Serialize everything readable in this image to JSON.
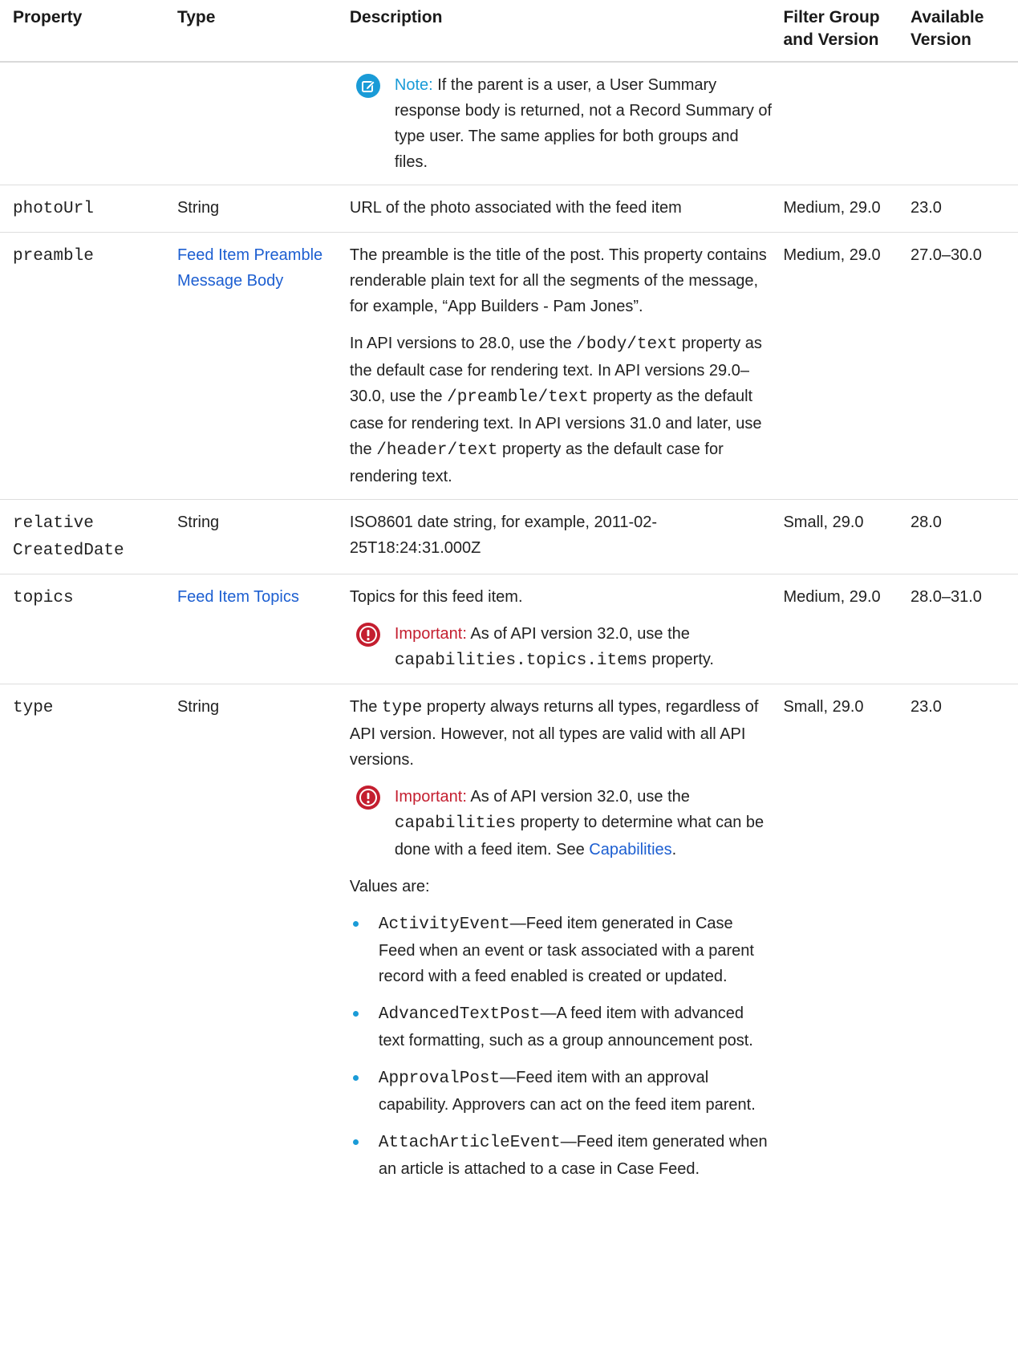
{
  "header": {
    "property": "Property",
    "type": "Type",
    "description": "Description",
    "filter": "Filter Group and Version",
    "available": "Available Version"
  },
  "rows": {
    "parent_cont": {
      "note_label": "Note:",
      "note_text": "If the parent is a user, a User Summary response body is returned, not a Record Summary of type user. The same applies for both groups and files."
    },
    "photoUrl": {
      "name": "photoUrl",
      "type": "String",
      "desc": "URL of the photo associated with the feed item",
      "filter": "Medium, 29.0",
      "available": "23.0"
    },
    "preamble": {
      "name": "preamble",
      "type_link": "Feed Item Preamble Message Body",
      "desc1": "The preamble is the title of the post. This property contains renderable plain text for all the segments of the message, for example, “App Builders - Pam Jones”.",
      "desc2_a": "In API versions to 28.0, use the",
      "code_body": "/body/text",
      "desc2_b": "property as the default case for rendering text. In API versions 29.0–30.0, use the",
      "code_preamble": "/preamble/text",
      "desc2_c": "property as the default case for rendering text. In API versions 31.0 and later, use the",
      "code_header": "/header/text",
      "desc2_d": "property as the default case for rendering text.",
      "filter": "Medium, 29.0",
      "available": "27.0–30.0"
    },
    "relativeCreatedDate": {
      "name_line1": "relative",
      "name_line2": "CreatedDate",
      "type": "String",
      "desc": "ISO8601 date string, for example, 2011-02-25T18:24:31.000Z",
      "filter": "Small, 29.0",
      "available": "28.0"
    },
    "topics": {
      "name": "topics",
      "type_link": "Feed Item Topics",
      "desc": "Topics for this feed item.",
      "imp_label": "Important:",
      "imp_a": "As of API version 32.0, use the",
      "imp_code": "capabilities.topics.items",
      "imp_b": "property.",
      "filter": "Medium, 29.0",
      "available": "28.0–31.0"
    },
    "type": {
      "name": "type",
      "type": "String",
      "desc_a": "The",
      "desc_code": "type",
      "desc_b": "property always returns all types, regardless of API version. However, not all types are valid with all API versions.",
      "imp_label": "Important:",
      "imp_a": "As of API version 32.0, use the",
      "imp_code": "capabilities",
      "imp_b": "property to determine what can be done with a feed item. See",
      "imp_link": "Capabilities",
      "imp_c": ".",
      "values_intro": "Values are:",
      "values": [
        {
          "code": "ActivityEvent",
          "text": "—Feed item generated in Case Feed when an event or task associated with a parent record with a feed enabled is created or updated."
        },
        {
          "code": "AdvancedTextPost",
          "text": "—A feed item with advanced text formatting, such as a group announcement post."
        },
        {
          "code": "ApprovalPost",
          "text": "—Feed item with an approval capability. Approvers can act on the feed item parent."
        },
        {
          "code": "AttachArticleEvent",
          "text": "—Feed item generated when an article is attached to a case in Case Feed."
        }
      ],
      "filter": "Small, 29.0",
      "available": "23.0"
    }
  },
  "colors": {
    "link": "#1d5fd1",
    "note": "#1a9bd7",
    "important": "#c41e2f"
  },
  "icons": {
    "note": "note-edit-icon",
    "important": "important-exclamation-icon"
  }
}
